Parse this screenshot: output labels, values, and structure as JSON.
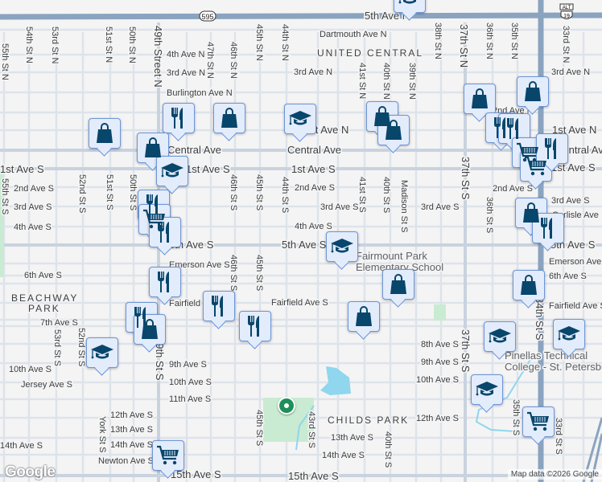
{
  "map": {
    "neighborhoods": [
      "UNITED CENTRAL",
      "BEACHWAY",
      "PARK",
      "CHILDS PARK"
    ],
    "route_shields": [
      "595",
      "ALT",
      "19"
    ],
    "avenues": [
      "5th Ave N",
      "Dartmouth Ave N",
      "4th Ave N",
      "3rd Ave N",
      "Burlington Ave N",
      "2nd Ave N",
      "1st Ave N",
      "Central Ave",
      "1st Ave S",
      "2nd Ave S",
      "3rd Ave S",
      "4th Ave S",
      "5th Ave S",
      "Emerson Ave S",
      "6th Ave S",
      "Fairfield Ave S",
      "7th Ave S",
      "8th Ave S",
      "9th Ave S",
      "10th Ave S",
      "11th Ave S",
      "12th Ave S",
      "13th Ave S",
      "14th Ave S",
      "Newton Ave S",
      "15th Ave S",
      "Jersey Ave S",
      "Carlisle Ave",
      "Fairfield"
    ],
    "streets": [
      "55th St N",
      "54th St N",
      "53rd St N",
      "51st St N",
      "50th St N",
      "49th Street N",
      "47th St N",
      "46th St N",
      "45th St N",
      "44th St N",
      "41st St N",
      "40th St N",
      "39th St N",
      "38th St N",
      "37th St N",
      "36th St N",
      "35th St N",
      "33rd St N",
      "55th St S",
      "52nd St S",
      "51st St S",
      "50th St S",
      "46th St S",
      "45th St S",
      "44th St S",
      "41st St S",
      "40th St S",
      "Madison St S",
      "37th St S",
      "36th St S",
      "35th St S",
      "34th St S",
      "33rd St S",
      "53rd St S",
      "York St S",
      "43rd St S",
      "49th St S"
    ],
    "pois": [
      "Fairmount Park",
      "Elementary School",
      "Pinellas Technical",
      "College - St. Petersburg"
    ],
    "markers": [
      "bag-icon",
      "restaurant-icon",
      "bag-icon",
      "school-icon",
      "bag-icon",
      "school-icon",
      "restaurant-icon",
      "cart-icon",
      "restaurant-icon",
      "bag-icon",
      "bag-icon",
      "bag-icon",
      "bag-icon",
      "restaurant-icon",
      "restaurant-icon",
      "cart-icon",
      "cart-icon",
      "restaurant-icon",
      "bag-icon",
      "restaurant-icon",
      "school-icon",
      "bag-icon",
      "bag-icon",
      "bag-icon",
      "restaurant-icon",
      "restaurant-icon",
      "restaurant-icon",
      "restaurant-icon",
      "bag-icon",
      "school-icon",
      "school-icon",
      "school-icon",
      "school-icon",
      "cart-icon",
      "cart-icon",
      "school-icon"
    ]
  },
  "footer": {
    "logo": "Google",
    "attribution": "Map data ©2026 Google"
  },
  "colors": {
    "highway": "#8aa4c0",
    "marker_bg": "#e3ecfb",
    "marker_border": "#6d95d8",
    "icon": "#08466b",
    "park": "#c9ebd2",
    "water": "#8fd6ee"
  }
}
